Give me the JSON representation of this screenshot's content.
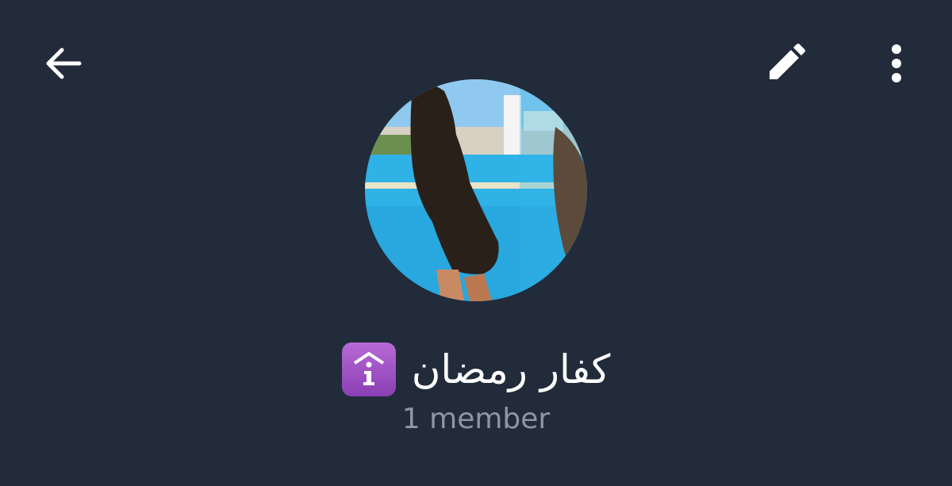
{
  "header": {
    "back_icon": "arrow-left-icon",
    "edit_icon": "pencil-icon",
    "more_icon": "more-vertical-icon"
  },
  "profile": {
    "avatar_icon": "group-avatar-photo",
    "name": "كفار رمضان",
    "badge_icon": "information-source-emoji",
    "subtitle": "1 member"
  },
  "colors": {
    "background": "#212b3a",
    "title": "#ffffff",
    "subtitle": "#8c96a4",
    "badge": "#9a4cc4"
  }
}
